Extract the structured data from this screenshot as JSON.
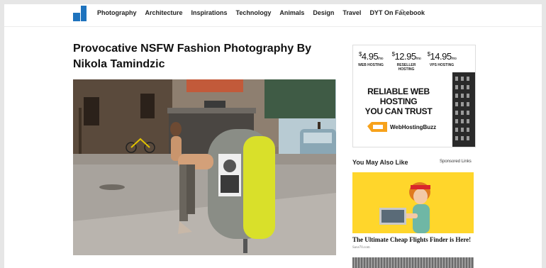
{
  "nav": {
    "items": [
      "Photography",
      "Architecture",
      "Inspirations",
      "Technology",
      "Animals",
      "Design",
      "Travel",
      "DYT On Facebook"
    ],
    "logo_icon": "logo-d-icon",
    "search_icon": "search-icon"
  },
  "article": {
    "title": "Provocative NSFW Fashion Photography By Nikola Tamindzic"
  },
  "ad": {
    "prices": [
      {
        "currency": "$",
        "amount": "4.95",
        "per": "/mo",
        "label": "WEB HOSTING"
      },
      {
        "currency": "$",
        "amount": "12.95",
        "per": "/mo",
        "label": "RESELLER HOSTING"
      },
      {
        "currency": "$",
        "amount": "14.95",
        "per": "/mo",
        "label": "VPS HOSTING"
      }
    ],
    "headline_line1": "RELIABLE WEB HOSTING",
    "headline_line2": "YOU CAN TRUST",
    "brand": "WebHostingBuzz"
  },
  "sidebar": {
    "section_title": "You May Also Like",
    "sponsored_label": "Sponsored Links",
    "promo_title": "The Ultimate Cheap Flights Finder is Here!",
    "promo_source": "Save70.com"
  },
  "colors": {
    "logo_blue": "#1e73be",
    "mailbox_yellow": "#d9e02a",
    "promo_yellow": "#ffd62b",
    "brand_orange": "#f7a21b"
  }
}
